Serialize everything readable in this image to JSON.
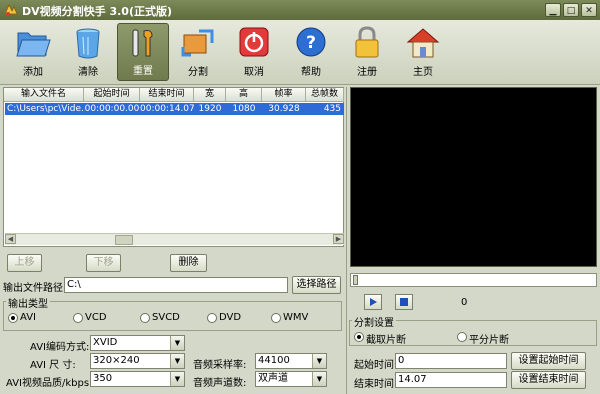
{
  "window": {
    "title": "DV视频分割快手 3.0(正式版)"
  },
  "toolbar": {
    "add": "添加",
    "clear": "清除",
    "reset": "重置",
    "split": "分割",
    "cancel": "取消",
    "help": "帮助",
    "register": "注册",
    "home": "主页"
  },
  "file_table": {
    "columns": [
      "输入文件名",
      "起始时间",
      "结束时间",
      "宽",
      "高",
      "帧率",
      "总帧数"
    ],
    "rows": [
      [
        "C:\\Users\\pc\\Vide...",
        "00:00:00.00",
        "00:00:14.07",
        "1920",
        "1080",
        "30.928",
        "435"
      ]
    ]
  },
  "list_buttons": {
    "up": "上移",
    "down": "下移",
    "delete": "删除"
  },
  "output": {
    "path_label": "输出文件路径:",
    "path_value": "C:\\",
    "browse": "选择路径"
  },
  "output_type": {
    "title": "输出类型",
    "options": [
      "AVI",
      "VCD",
      "SVCD",
      "DVD",
      "WMV"
    ],
    "selected": "AVI"
  },
  "encoding": {
    "codec_label": "AVI编码方式:",
    "codec_value": "XVID",
    "size_label": "AVI  尺  寸:",
    "size_value": "320×240",
    "quality_label": "AVI视频品质/kbps:",
    "quality_value": "350",
    "samplerate_label": "音频采样率:",
    "samplerate_value": "44100",
    "channels_label": "音频声道数:",
    "channels_value": "双声道"
  },
  "player": {
    "frame_counter": "0"
  },
  "split_settings": {
    "title": "分割设置",
    "opt_clip": "截取片断",
    "opt_even": "平分片断",
    "selected": "截取片断",
    "start_label": "起始时间:",
    "start_value": "0",
    "end_label": "结束时间:",
    "end_value": "14.07",
    "set_start": "设置起始时间",
    "set_end": "设置结束时间"
  }
}
